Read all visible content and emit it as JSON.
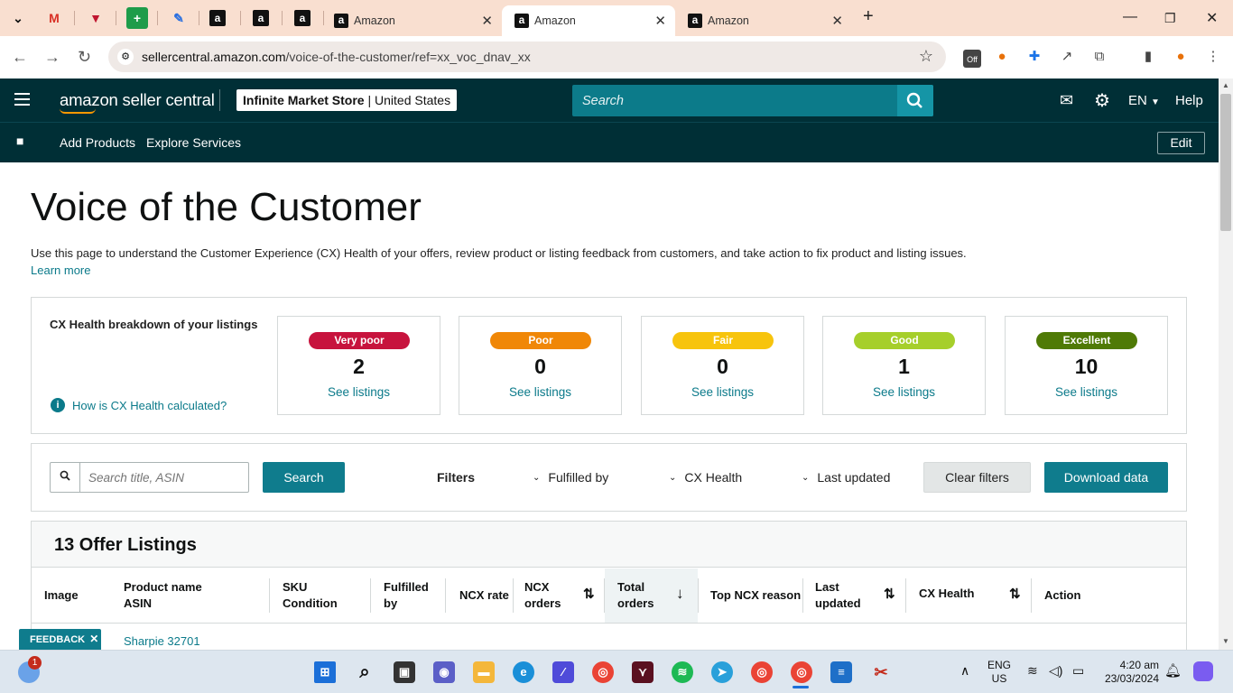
{
  "browser": {
    "tabs": [
      {
        "title": "Amazon",
        "active": false
      },
      {
        "title": "Amazon",
        "active": true
      },
      {
        "title": "Amazon",
        "active": false
      }
    ],
    "url_domain": "sellercentral.amazon.com",
    "url_path": "/voice-of-the-customer/ref=xx_voc_dnav_xx",
    "ext_off_badge": "Off"
  },
  "header": {
    "logo_text": "amazon seller central",
    "store_name": "Infinite Market Store",
    "store_region": "United States",
    "search_placeholder": "Search",
    "language": "EN",
    "help": "Help",
    "nav": [
      "Add Products",
      "Explore Services"
    ],
    "edit_label": "Edit"
  },
  "page": {
    "title": "Voice of the Customer",
    "intro": "Use this page to understand the Customer Experience (CX) Health of your offers, review product or listing feedback from customers, and take action to fix product and listing issues.",
    "learn_more": "Learn more"
  },
  "cx": {
    "label": "CX Health breakdown of your listings",
    "how_link": "How is CX Health calculated?",
    "cards": [
      {
        "label": "Very poor",
        "count": "2",
        "link": "See listings",
        "color": "#c7133d"
      },
      {
        "label": "Poor",
        "count": "0",
        "link": "See listings",
        "color": "#f08707"
      },
      {
        "label": "Fair",
        "count": "0",
        "link": "See listings",
        "color": "#f7c40d"
      },
      {
        "label": "Good",
        "count": "1",
        "link": "See listings",
        "color": "#a6cf2b"
      },
      {
        "label": "Excellent",
        "count": "10",
        "link": "See listings",
        "color": "#4f7a06"
      }
    ]
  },
  "filters": {
    "search_placeholder": "Search title, ASIN",
    "search_button": "Search",
    "filters_label": "Filters",
    "dropdowns": [
      "Fulfilled by",
      "CX Health",
      "Last updated"
    ],
    "clear": "Clear filters",
    "download": "Download data"
  },
  "listings": {
    "title": "13 Offer Listings",
    "columns": [
      {
        "line1": "Image",
        "line2": ""
      },
      {
        "line1": "Product name",
        "line2": "ASIN"
      },
      {
        "line1": "SKU",
        "line2": "Condition"
      },
      {
        "line1": "Fulfilled",
        "line2": "by"
      },
      {
        "line1": "NCX rate",
        "line2": ""
      },
      {
        "line1": "NCX",
        "line2": "orders"
      },
      {
        "line1": "Total",
        "line2": "orders"
      },
      {
        "line1": "Top NCX reason",
        "line2": ""
      },
      {
        "line1": "Last",
        "line2": "updated"
      },
      {
        "line1": "CX Health",
        "line2": ""
      },
      {
        "line1": "Action",
        "line2": ""
      }
    ],
    "first_row_product": "Sharpie 32701"
  },
  "feedback": "FEEDBACK",
  "taskbar": {
    "weather_badge": "1",
    "lang_line1": "ENG",
    "lang_line2": "US",
    "time": "4:20 am",
    "date": "23/03/2024"
  }
}
